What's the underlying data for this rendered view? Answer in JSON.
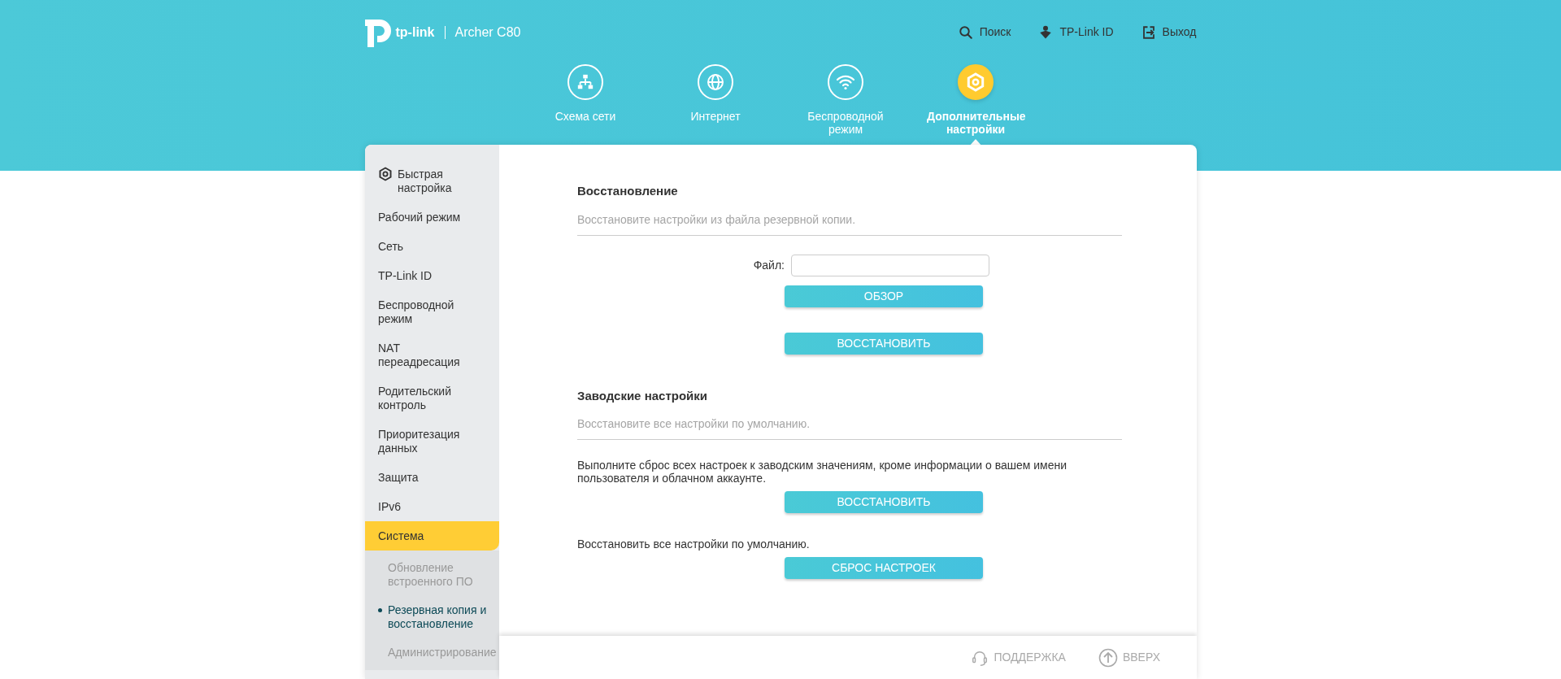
{
  "header": {
    "brand": "tp-link",
    "model": "Archer C80",
    "links": [
      {
        "kind": "search",
        "label": "Поиск"
      },
      {
        "kind": "account",
        "label": "TP-Link ID"
      },
      {
        "kind": "logout",
        "label": "Выход"
      }
    ]
  },
  "main_nav": [
    {
      "kind": "network-map",
      "label": "Схема сети",
      "selected": false
    },
    {
      "kind": "internet",
      "label": "Интернет",
      "selected": false
    },
    {
      "kind": "wireless",
      "label": "Беспроводной режим",
      "selected": false
    },
    {
      "kind": "advanced",
      "label": "Дополнительные настройки",
      "selected": true
    }
  ],
  "sidebar": {
    "items": [
      {
        "label": "Быстрая настройка",
        "kind": "quick-setup",
        "selected": false
      },
      {
        "label": "Рабочий режим",
        "selected": false
      },
      {
        "label": "Сеть",
        "selected": false
      },
      {
        "label": "TP-Link ID",
        "selected": false
      },
      {
        "label": "Беспроводной режим",
        "selected": false
      },
      {
        "label": "NAT переадресация",
        "selected": false
      },
      {
        "label": "Родительский контроль",
        "selected": false
      },
      {
        "label": "Приоритезация данных",
        "selected": false
      },
      {
        "label": "Защита",
        "selected": false
      },
      {
        "label": "IPv6",
        "selected": false
      },
      {
        "label": "Система",
        "selected": true,
        "expanded": true,
        "children": [
          {
            "label": "Обновление встроенного ПО",
            "selected": false
          },
          {
            "label": "Резервная копия и восстановление",
            "selected": true
          },
          {
            "label": "Администрирование",
            "selected": false
          }
        ]
      }
    ]
  },
  "sections": [
    {
      "title": "Восстановление",
      "subtitle": "Восстановите настройки из файла резервной копии.",
      "items": [
        {
          "kind": "field",
          "label": "Файл:"
        },
        {
          "kind": "button",
          "label": "ОБЗОР"
        },
        {
          "kind": "button",
          "label": "ВОССТАНОВИТЬ"
        }
      ]
    },
    {
      "title": "Заводские настройки",
      "subtitle": "Восстановите все настройки по умолчанию.",
      "items": [
        {
          "kind": "text",
          "label": "Выполните сброс всех настроек к заводским значениям, кроме информации о вашем имени пользователя и облачном аккаунте."
        },
        {
          "kind": "button",
          "label": "ВОССТАНОВИТЬ"
        },
        {
          "kind": "text",
          "label": "Восстановить все настройки по умолчанию."
        },
        {
          "kind": "button",
          "label": "СБРОС НАСТРОЕК"
        }
      ]
    }
  ],
  "footer": [
    {
      "kind": "support",
      "label": "ПОДДЕРЖКА"
    },
    {
      "kind": "top",
      "label": "ВВЕРХ"
    }
  ]
}
